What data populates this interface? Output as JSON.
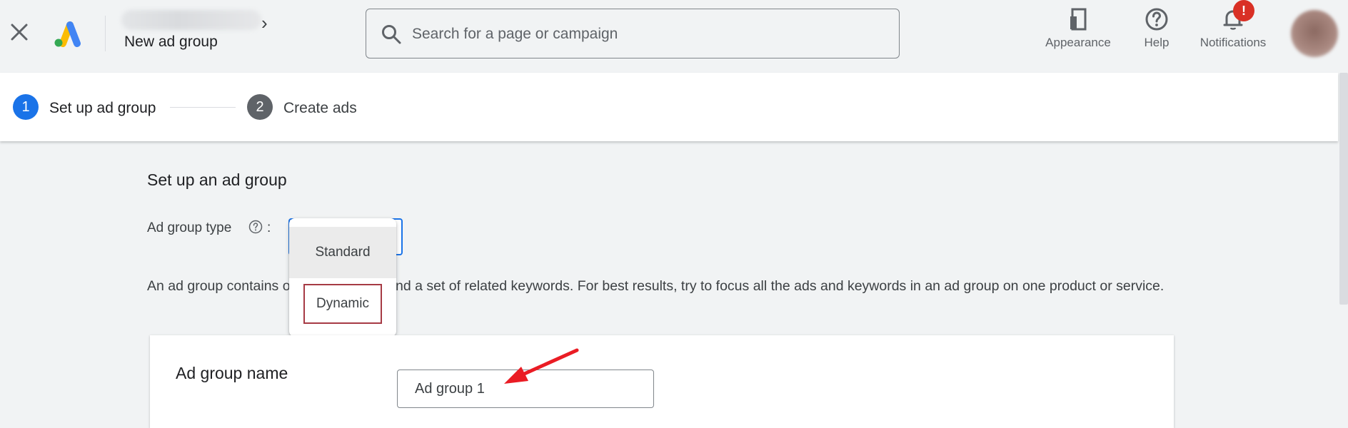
{
  "header": {
    "page_title": "New ad group",
    "search_placeholder": "Search for a page or campaign",
    "tools": [
      {
        "label": "Appearance",
        "icon": "appearance-icon"
      },
      {
        "label": "Help",
        "icon": "help-icon"
      },
      {
        "label": "Notifications",
        "icon": "bell-icon"
      }
    ],
    "notification_badge": "!"
  },
  "stepper": {
    "steps": [
      {
        "number": "1",
        "label": "Set up ad group",
        "state": "active"
      },
      {
        "number": "2",
        "label": "Create ads",
        "state": "upcoming"
      }
    ]
  },
  "main": {
    "section_title": "Set up an ad group",
    "ad_group_type_label": "Ad group type",
    "colon": ":",
    "description": "An ad group contains one or more ads and a set of related keywords. For best results, try to focus all the ads and keywords in an ad group on one product or service.",
    "dropdown_options": [
      "Standard",
      "Dynamic"
    ],
    "ad_group_name_label": "Ad group name",
    "ad_group_name_value": "Ad group 1"
  },
  "colors": {
    "accent": "#1a73e8",
    "badge": "#d93025",
    "highlight_box": "#a63a44",
    "annotation_arrow": "#ea1c24"
  }
}
